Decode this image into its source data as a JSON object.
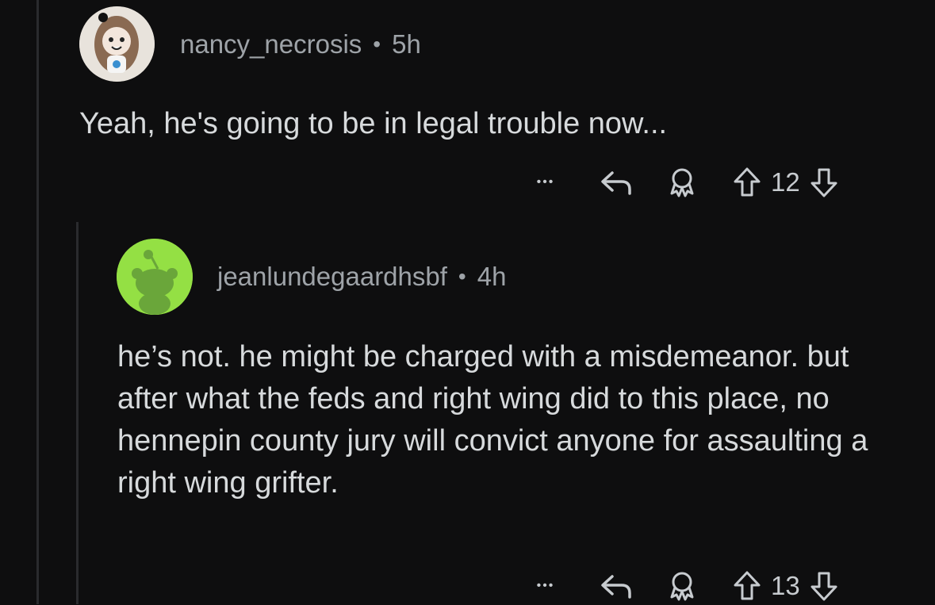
{
  "comments": [
    {
      "username": "nancy_necrosis",
      "separator": "•",
      "time": "5h",
      "body": "Yeah, he's going to be in legal trouble now...",
      "score": "12",
      "icons": [
        "more-icon",
        "reply-icon",
        "award-icon",
        "upvote-icon",
        "downvote-icon"
      ]
    },
    {
      "username": "jeanlundegaardhsbf",
      "separator": "•",
      "time": "4h",
      "body": "he’s not. he might be charged with a misdemeanor. but after what the feds and right wing did to this place, no hennepin county jury will convict anyone for assaulting a right wing grifter.",
      "score": "13",
      "icons": [
        "more-icon",
        "reply-icon",
        "award-icon",
        "upvote-icon",
        "downvote-icon"
      ]
    }
  ],
  "colors": {
    "background": "#0e0e0f",
    "text": "#d7dadc",
    "meta": "#9ea3a8",
    "avatar2_bg": "#94e044"
  },
  "more_glyph": "•••"
}
